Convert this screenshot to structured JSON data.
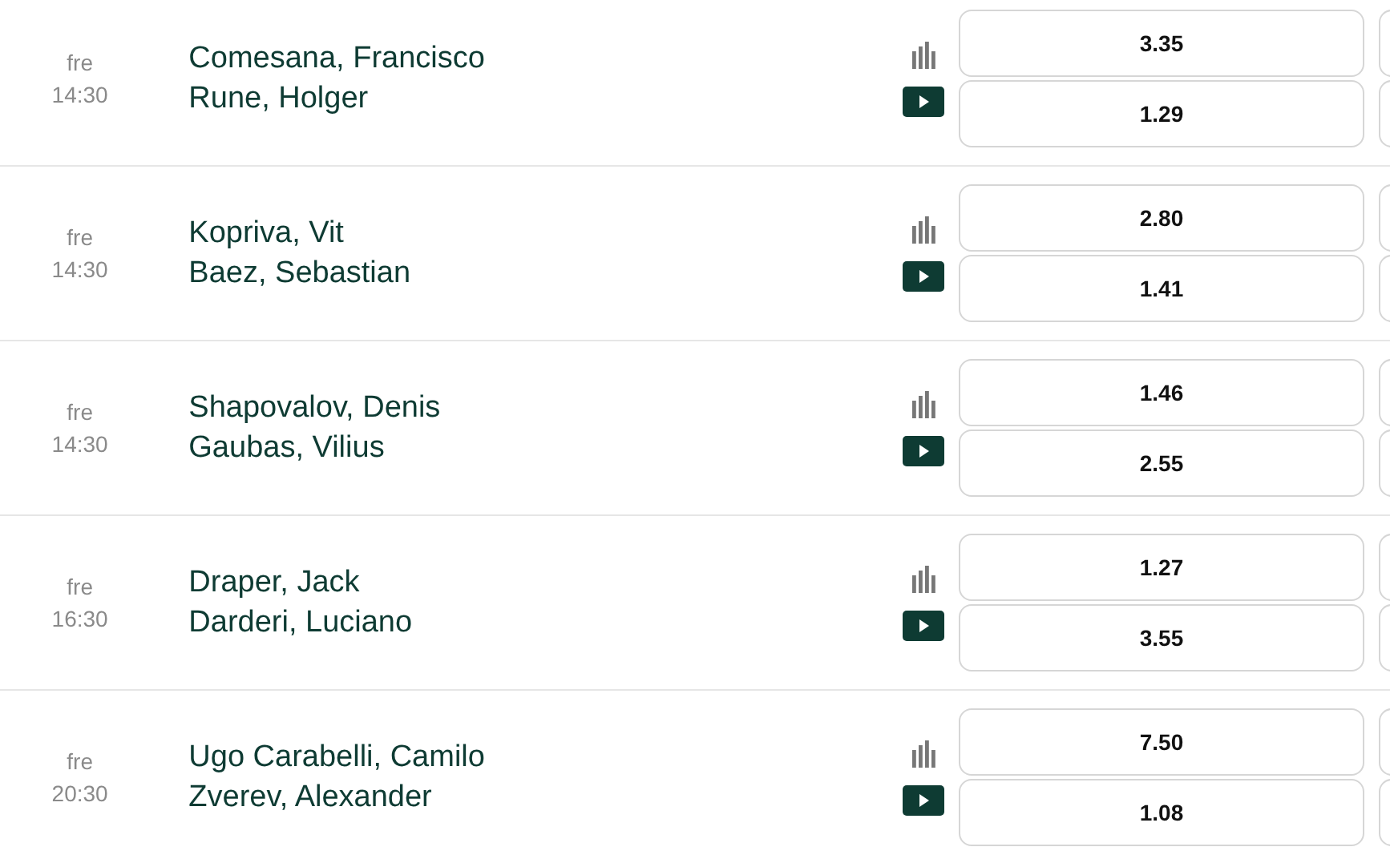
{
  "matches": [
    {
      "day": "fre",
      "time": "14:30",
      "players": [
        "Comesana, Francisco",
        "Rune, Holger"
      ],
      "odds": [
        "3.35",
        "1.29"
      ]
    },
    {
      "day": "fre",
      "time": "14:30",
      "players": [
        "Kopriva, Vit",
        "Baez, Sebastian"
      ],
      "odds": [
        "2.80",
        "1.41"
      ]
    },
    {
      "day": "fre",
      "time": "14:30",
      "players": [
        "Shapovalov, Denis",
        "Gaubas, Vilius"
      ],
      "odds": [
        "1.46",
        "2.55"
      ]
    },
    {
      "day": "fre",
      "time": "16:30",
      "players": [
        "Draper, Jack",
        "Darderi, Luciano"
      ],
      "odds": [
        "1.27",
        "3.55"
      ]
    },
    {
      "day": "fre",
      "time": "20:30",
      "players": [
        "Ugo Carabelli, Camilo",
        "Zverev, Alexander"
      ],
      "odds": [
        "7.50",
        "1.08"
      ]
    }
  ]
}
